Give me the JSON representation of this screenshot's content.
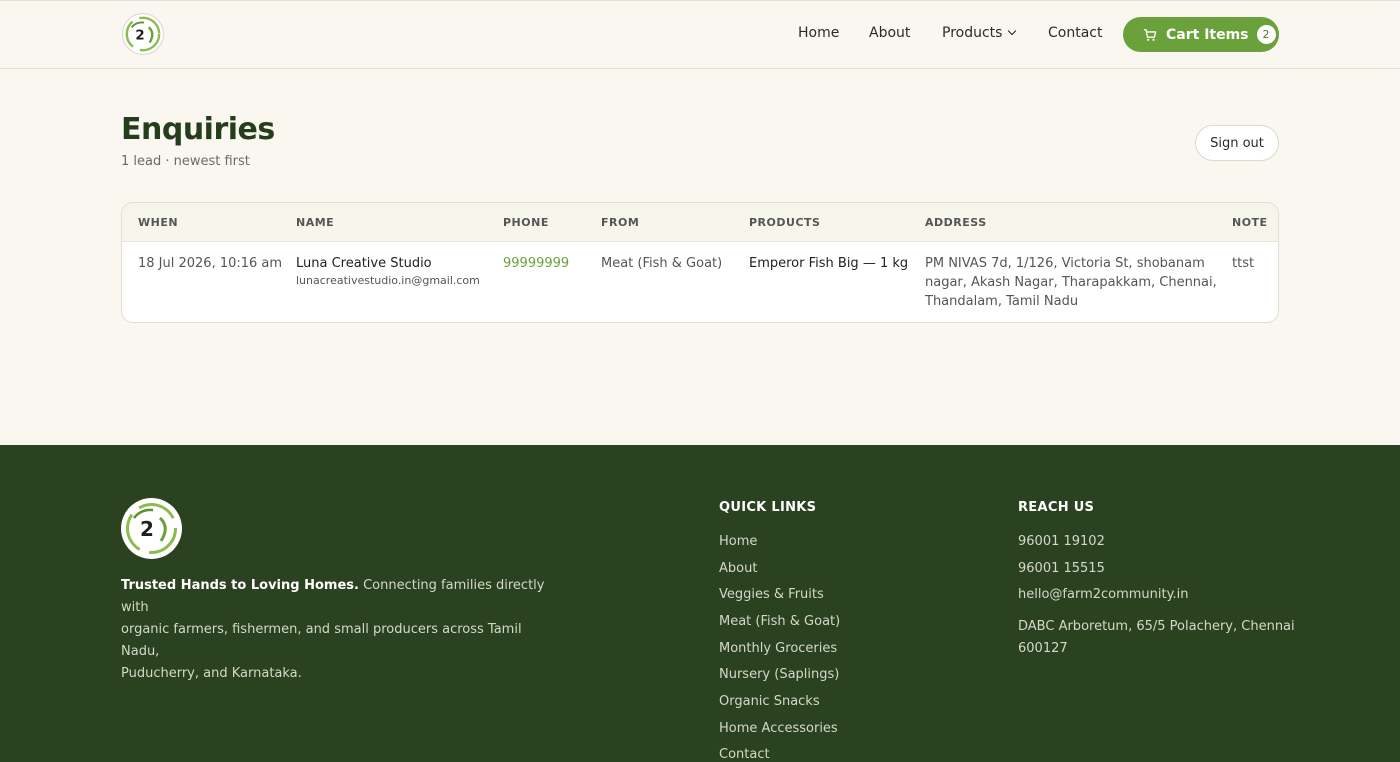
{
  "header": {
    "nav": {
      "home": "Home",
      "about": "About",
      "products": "Products",
      "contact": "Contact"
    },
    "cart": {
      "label": "Cart Items",
      "count": "2"
    },
    "accent_color": "#6aa13b"
  },
  "main": {
    "title": "Enquiries",
    "subtitle": "1 lead · newest first",
    "sign_out": "Sign out",
    "table": {
      "headers": {
        "when": "WHEN",
        "name": "NAME",
        "phone": "PHONE",
        "from": "FROM",
        "products": "PRODUCTS",
        "address": "ADDRESS",
        "note": "NOTE"
      },
      "rows": [
        {
          "when": "18 Jul 2026, 10:16 am",
          "name": "Luna Creative Studio",
          "email": "lunacreativestudio.in@gmail.com",
          "phone": "99999999",
          "from": "Meat (Fish & Goat)",
          "products": "Emperor Fish Big — 1 kg",
          "address_line1": "PM NIVAS 7d, 1/126, Victoria St, shobanam",
          "address_line2": "nagar, Akash Nagar, Tharapakkam, Chennai,",
          "address_line3": "Thandalam, Tamil Nadu",
          "note": "ttst"
        }
      ]
    }
  },
  "footer": {
    "about_bold": "Trusted Hands to Loving Homes.",
    "about_line1": " Connecting families directly with",
    "about_line2": "organic farmers, fishermen, and small producers across Tamil Nadu,",
    "about_line3": "Puducherry, and Karnataka.",
    "quick_links_heading": "QUICK LINKS",
    "quick_links": [
      "Home",
      "About",
      "Veggies & Fruits",
      "Meat (Fish & Goat)",
      "Monthly Groceries",
      "Nursery (Saplings)",
      "Organic Snacks",
      "Home Accessories",
      "Contact"
    ],
    "reach_heading": "REACH US",
    "phone1": "96001 19102",
    "phone2": "96001 15515",
    "email": "hello@farm2community.in",
    "address_line1": "DABC Arboretum, 65/5 Polachery, Chennai",
    "address_line2": "600127",
    "bg_color": "#2b4220"
  }
}
